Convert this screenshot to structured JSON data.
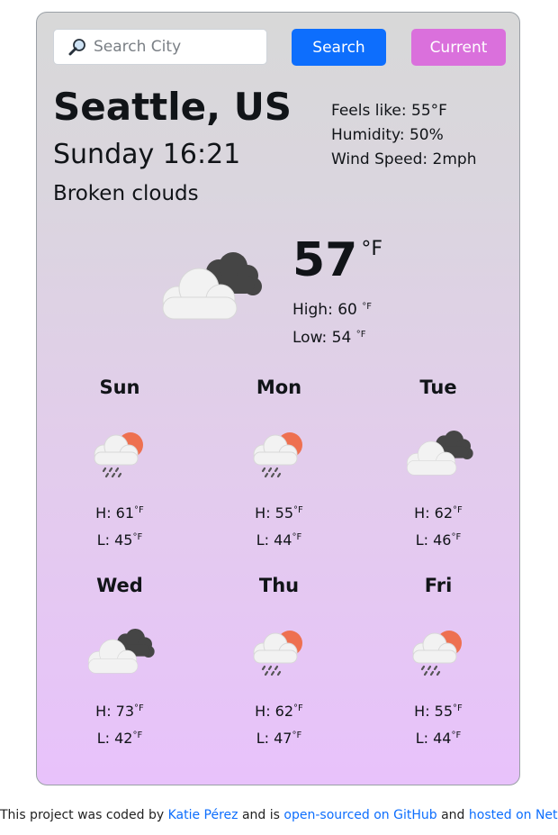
{
  "search": {
    "placeholder": "Search City",
    "button_label": "Search",
    "current_label": "Current"
  },
  "current": {
    "city": "Seattle, US",
    "datetime": "Sunday 16:21",
    "description": "Broken clouds",
    "feels_like": "Feels like: 55°F",
    "humidity": "Humidity: 50%",
    "wind": "Wind Speed: 2mph",
    "temperature": "57",
    "unit": "°F",
    "high_label": "High: 60",
    "low_label": "Low: 54",
    "small_unit": "°F",
    "icon": "broken-clouds-icon"
  },
  "forecast": [
    {
      "day": "Sun",
      "icon": "rain-sun-icon",
      "high": "H: 61",
      "low": "L: 45",
      "unit": "°F"
    },
    {
      "day": "Mon",
      "icon": "rain-sun-icon",
      "high": "H: 55",
      "low": "L: 44",
      "unit": "°F"
    },
    {
      "day": "Tue",
      "icon": "broken-clouds-icon",
      "high": "H: 62",
      "low": "L: 46",
      "unit": "°F"
    },
    {
      "day": "Wed",
      "icon": "broken-clouds-icon",
      "high": "H: 73",
      "low": "L: 42",
      "unit": "°F"
    },
    {
      "day": "Thu",
      "icon": "rain-sun-icon",
      "high": "H: 62",
      "low": "L: 47",
      "unit": "°F"
    },
    {
      "day": "Fri",
      "icon": "rain-sun-icon",
      "high": "H: 55",
      "low": "L: 44",
      "unit": "°F"
    }
  ],
  "footer": {
    "text1": "This project was coded by ",
    "author": "Katie Pérez",
    "text2": " and is ",
    "github": "open-sourced on GitHub",
    "text3": " and ",
    "netlify": "hosted on Netlify"
  },
  "colors": {
    "primary_button": "#0d6efd",
    "current_button": "#da70dc",
    "link": "#0d6efd",
    "sun": "#ee7050"
  }
}
